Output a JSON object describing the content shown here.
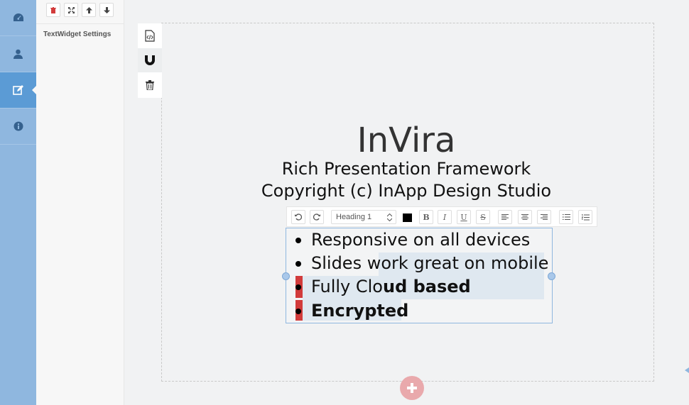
{
  "sidebar": {
    "items": [
      {
        "icon": "dashboard-icon"
      },
      {
        "icon": "user-icon"
      },
      {
        "icon": "edit-icon",
        "active": true
      },
      {
        "icon": "info-icon"
      }
    ]
  },
  "settings_panel": {
    "toolbar": [
      "delete-icon",
      "expand-icon",
      "arrow-up-icon",
      "arrow-down-icon"
    ],
    "title": "TextWidget Settings"
  },
  "slide": {
    "title": "InVira",
    "subtitle1": "Rich Presentation Framework",
    "subtitle2": "Copyright (c) InApp Design Studio"
  },
  "editor_toolbar": {
    "format_select": "Heading 1",
    "color": "#000000",
    "bold_label": "B",
    "italic_label": "I",
    "underline_label": "U",
    "strike_label": "S"
  },
  "text_widget": {
    "items": [
      {
        "text": "Responsive on all devices"
      },
      {
        "text_a": "Slides wo",
        "text_b": "rk great on mobile"
      },
      {
        "text_a": "Fully Clo",
        "text_b": "ud based"
      },
      {
        "text": "Encrypted"
      }
    ]
  },
  "colors": {
    "sidebar": "#8fb7df",
    "sidebar_active": "#5b9bd5",
    "accent_red": "#d23b3b",
    "add_button": "#e9a9ac"
  }
}
